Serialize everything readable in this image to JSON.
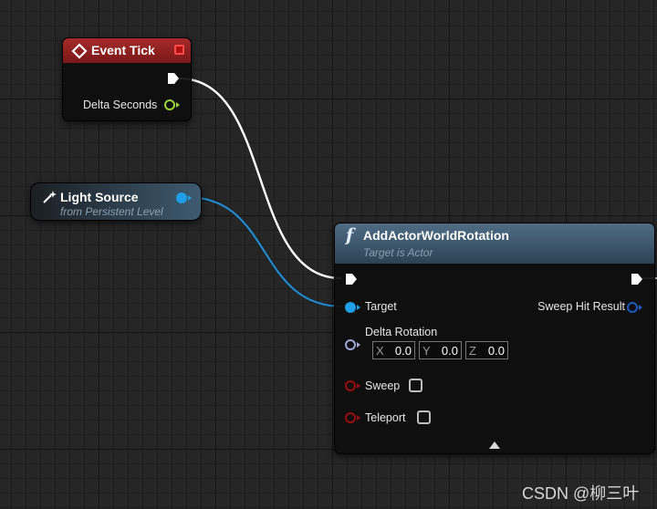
{
  "event_tick": {
    "title": "Event Tick",
    "delta_seconds_label": "Delta Seconds"
  },
  "light_source": {
    "title": "Light Source",
    "subtitle": "from Persistent Level"
  },
  "add_rotation": {
    "function_icon": "f",
    "title": "AddActorWorldRotation",
    "subtitle": "Target is Actor",
    "target_label": "Target",
    "sweep_hit_result_label": "Sweep Hit Result",
    "delta_rotation_label": "Delta Rotation",
    "x_label": "X",
    "x_value": "0.0",
    "y_label": "Y",
    "y_value": "0.0",
    "z_label": "Z",
    "z_value": "0.0",
    "sweep_label": "Sweep",
    "sweep_checked": false,
    "teleport_label": "Teleport",
    "teleport_checked": false
  },
  "watermark": "CSDN @柳三叶",
  "colors": {
    "event_header": "#8a1d1d",
    "function_header": "#3f5a70",
    "exec_wire": "#ffffff",
    "object_pin": "#1e9fe8",
    "float_pin": "#9ad53a",
    "bool_pin": "#9a0f0f",
    "struct_pin": "#1b5cc2",
    "rotator_pin": "#a0a9d6"
  },
  "icons": [
    "event-diamond-icon",
    "stop-icon",
    "light-source-icon",
    "function-icon",
    "collapse-arrow-icon"
  ]
}
